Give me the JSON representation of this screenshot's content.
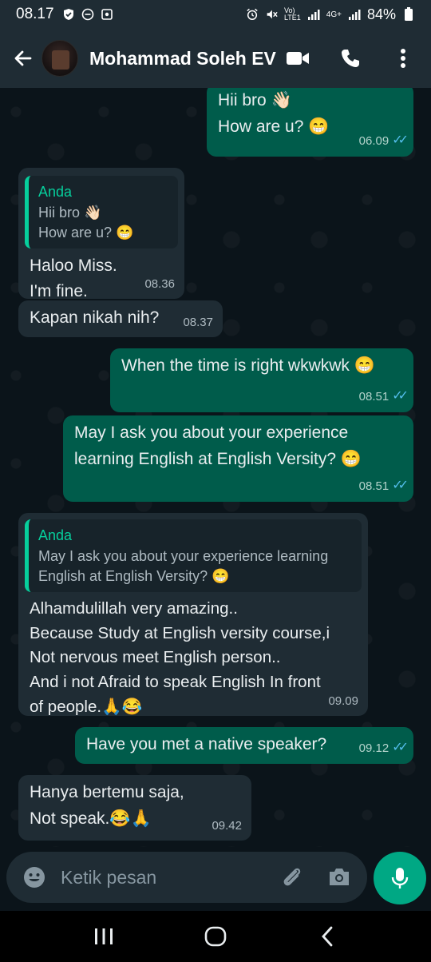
{
  "status_bar": {
    "time": "08.17",
    "network_label": "Vo)\nLTE1",
    "network_label_top": "Vo)",
    "network_label_bottom": "LTE1",
    "data_label": "4G+",
    "battery": "84%"
  },
  "header": {
    "contact_name": "Mohammad Soleh EV"
  },
  "messages": [
    {
      "direction": "out",
      "lines": [
        "Hii bro 👋🏻",
        "How are u? 😁"
      ],
      "time": "06.09",
      "read": true
    },
    {
      "direction": "in",
      "quote_author": "Anda",
      "quote_lines": [
        "Hii bro 👋🏻",
        "How are u? 😁"
      ],
      "lines": [
        "Haloo Miss.",
        "I'm fine."
      ],
      "time": "08.36"
    },
    {
      "direction": "in",
      "lines": [
        "Kapan nikah nih?"
      ],
      "time": "08.37"
    },
    {
      "direction": "out",
      "lines": [
        "When the time is right wkwkwk 😁"
      ],
      "time": "08.51",
      "read": true
    },
    {
      "direction": "out",
      "lines": [
        "May I ask you about your experience",
        "learning English at English Versity? 😁"
      ],
      "time": "08.51",
      "read": true
    },
    {
      "direction": "in",
      "quote_author": "Anda",
      "quote_lines": [
        "May I ask you about your experience learning",
        "English at English Versity? 😁"
      ],
      "lines": [
        "Alhamdulillah very amazing..",
        "Because Study at English versity course,i",
        "Not nervous  meet English person..",
        "And i not Afraid to speak English In front",
        "of people.🙏😂"
      ],
      "time": "09.09"
    },
    {
      "direction": "out",
      "lines": [
        "Have you met a native speaker?"
      ],
      "time": "09.12",
      "read": true
    },
    {
      "direction": "in",
      "lines": [
        "Hanya bertemu saja,",
        "Not speak.😂🙏"
      ],
      "time": "09.42"
    }
  ],
  "input": {
    "placeholder": "Ketik pesan"
  },
  "icons": {
    "back": "arrow-left-icon",
    "video": "video-camera-icon",
    "call": "phone-icon",
    "menu": "more-vertical-icon",
    "emoji": "emoji-icon",
    "attach": "paperclip-icon",
    "camera": "camera-icon",
    "mic": "microphone-icon",
    "nav_recent": "recent-apps-icon",
    "nav_home": "home-icon",
    "nav_back": "nav-back-icon"
  },
  "colors": {
    "outgoing_bubble": "#005c4b",
    "incoming_bubble": "#1f2c34",
    "accent": "#00a884",
    "read_ticks": "#53bdeb"
  }
}
